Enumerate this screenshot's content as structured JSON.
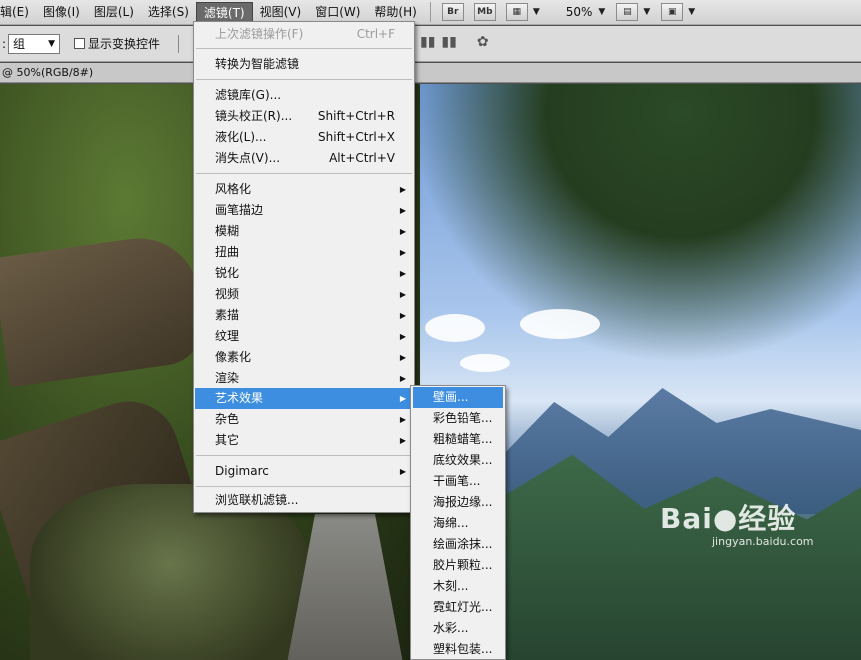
{
  "menubar": {
    "items": [
      {
        "label": "辑(E)",
        "active": false
      },
      {
        "label": "图像(I)",
        "active": false
      },
      {
        "label": "图层(L)",
        "active": false
      },
      {
        "label": "选择(S)",
        "active": false
      },
      {
        "label": "滤镜(T)",
        "active": true
      },
      {
        "label": "视图(V)",
        "active": false
      },
      {
        "label": "窗口(W)",
        "active": false
      },
      {
        "label": "帮助(H)",
        "active": false
      }
    ],
    "bridge_label": "Br",
    "minibridge_label": "Mb",
    "zoom": "50%"
  },
  "options": {
    "group_value": "组",
    "transform_label": "显示变换控件"
  },
  "document": {
    "tab_title": "@ 50%(RGB/8#)"
  },
  "filter_menu": {
    "last_filter": {
      "label": "上次滤镜操作(F)",
      "shortcut": "Ctrl+F"
    },
    "convert_smart": "转换为智能滤镜",
    "gallery": "滤镜库(G)...",
    "lens": {
      "label": "镜头校正(R)...",
      "shortcut": "Shift+Ctrl+R"
    },
    "liquify": {
      "label": "液化(L)...",
      "shortcut": "Shift+Ctrl+X"
    },
    "vanish": {
      "label": "消失点(V)...",
      "shortcut": "Alt+Ctrl+V"
    },
    "categories": [
      "风格化",
      "画笔描边",
      "模糊",
      "扭曲",
      "锐化",
      "视频",
      "素描",
      "纹理",
      "像素化",
      "渲染",
      "艺术效果",
      "杂色",
      "其它"
    ],
    "digimarc": "Digimarc",
    "browse_online": "浏览联机滤镜..."
  },
  "artistic_submenu": {
    "items": [
      "壁画...",
      "彩色铅笔...",
      "粗糙蜡笔...",
      "底纹效果...",
      "干画笔...",
      "海报边缘...",
      "海绵...",
      "绘画涂抹...",
      "胶片颗粒...",
      "木刻...",
      "霓虹灯光...",
      "水彩...",
      "塑料包装..."
    ]
  },
  "watermark": {
    "brand": "Bai",
    "brand_cn": "经验",
    "url": "jingyan.baidu.com"
  },
  "colors": {
    "highlight": "#3d8ee0",
    "menu_bg": "#f0f0f0"
  }
}
